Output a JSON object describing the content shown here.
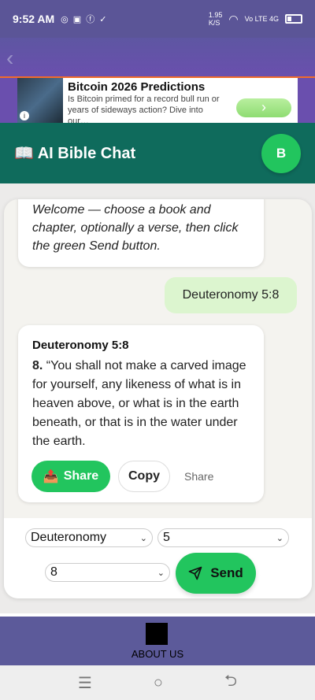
{
  "status_bar": {
    "time": "9:52 AM",
    "icons": [
      "whatsapp-icon",
      "app-icon",
      "facebook-icon",
      "download-done-icon"
    ],
    "speed": "1.95",
    "speed_unit": "K/S",
    "network": "Vo LTE 4G"
  },
  "ad": {
    "title": "Bitcoin 2026 Predictions",
    "description": "Is Bitcoin primed for a record bull run or years of sideways action? Dive into our…",
    "button_icon": "chevron-right-icon"
  },
  "header": {
    "icon": "📖",
    "title": "AI Bible Chat",
    "avatar_letter": "B"
  },
  "chat": {
    "welcome": "Welcome — choose a book and chapter, optionally a verse, then click the green Send button.",
    "user_message": "Deuteronomy 5:8",
    "verse_reference": "Deuteronomy 5:8",
    "verse_number": "8.",
    "verse_text": "“You shall not make a carved image for yourself, any likeness of what is in heaven above, or what is in the earth beneath, or that is in the water under the earth.",
    "share_button": "Share",
    "share_icon": "📤",
    "copy_button": "Copy",
    "share_link": "Share"
  },
  "controls": {
    "book": "Deuteronomy",
    "chapter": "5",
    "verse": "8",
    "send_label": "Send"
  },
  "footer": {
    "about_label": "ABOUT US"
  },
  "colors": {
    "status_bar": "#5b5597",
    "header": "#0f6b5c",
    "accent_green": "#22c55e",
    "user_bubble": "#dcf5cf"
  }
}
